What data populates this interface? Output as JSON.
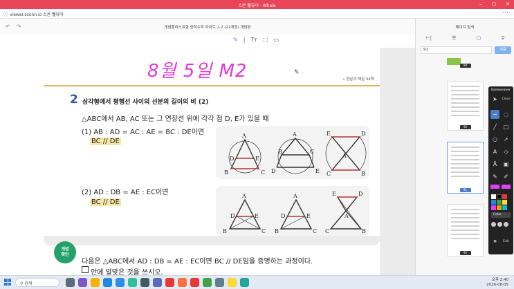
{
  "window": {
    "title": "스콘 웰뷰어 - Whale",
    "controls": [
      "–",
      "▢",
      "✕"
    ]
  },
  "address_bar": {
    "url": "viewer.sconn.io  스콘 웰뷰어"
  },
  "viewer": {
    "doc_title": "개념플러스유형 중학수학 라이트 2-2 (22개정) 개념편"
  },
  "page": {
    "handwriting": "8월 5일  M2",
    "answer_link": "» 정답과 해설 44쪽",
    "section_number": "2",
    "section_title": "삼각형에서 평행선 사이의 선분의 길이의 비 (2)",
    "intro": "△ABC에서 AB, AC 또는 그 연장선 위에 각각 점 D, E가 있을 때",
    "case1": "(1)  AB : AD = AC : AE = BC : DE이면",
    "case1_result": "BC // DE",
    "case2": "(2)  AD : DB = AE : EC이면",
    "case2_result": "BC // DE",
    "confirm_badge": [
      "개념",
      "확인"
    ],
    "exercise_line1": "다음은 △ABC에서 AD : DB = AE : EC이면 BC // DE임을 증명하는 과정이다.",
    "exercise_line2": "안에 알맞은 것을 쓰시오.",
    "fig_labels": {
      "A": "A",
      "B": "B",
      "C": "C",
      "D": "D",
      "E": "E"
    }
  },
  "panel": {
    "title": "페이지 탐색",
    "tabs": [
      "⊢|",
      "☰",
      "▢",
      "⚲"
    ],
    "page_input": "91",
    "go_button": "이동",
    "thumb_numbers": [
      "89",
      "90",
      "91",
      "92"
    ]
  },
  "palette": {
    "title": "Kamiweaver",
    "clear_label": "Clear",
    "color_label": "Color",
    "edit_label": "Edit",
    "colors": [
      "#ffffff",
      "#000000",
      "#e53935",
      "#1e88e5",
      "#43a047",
      "#fdd835",
      "#e040fb",
      "#ff9800",
      "#00bcd4"
    ]
  },
  "taskbar": {
    "search_placeholder": "검색",
    "time": "오후 2:40",
    "date": "2026-08-05"
  }
}
